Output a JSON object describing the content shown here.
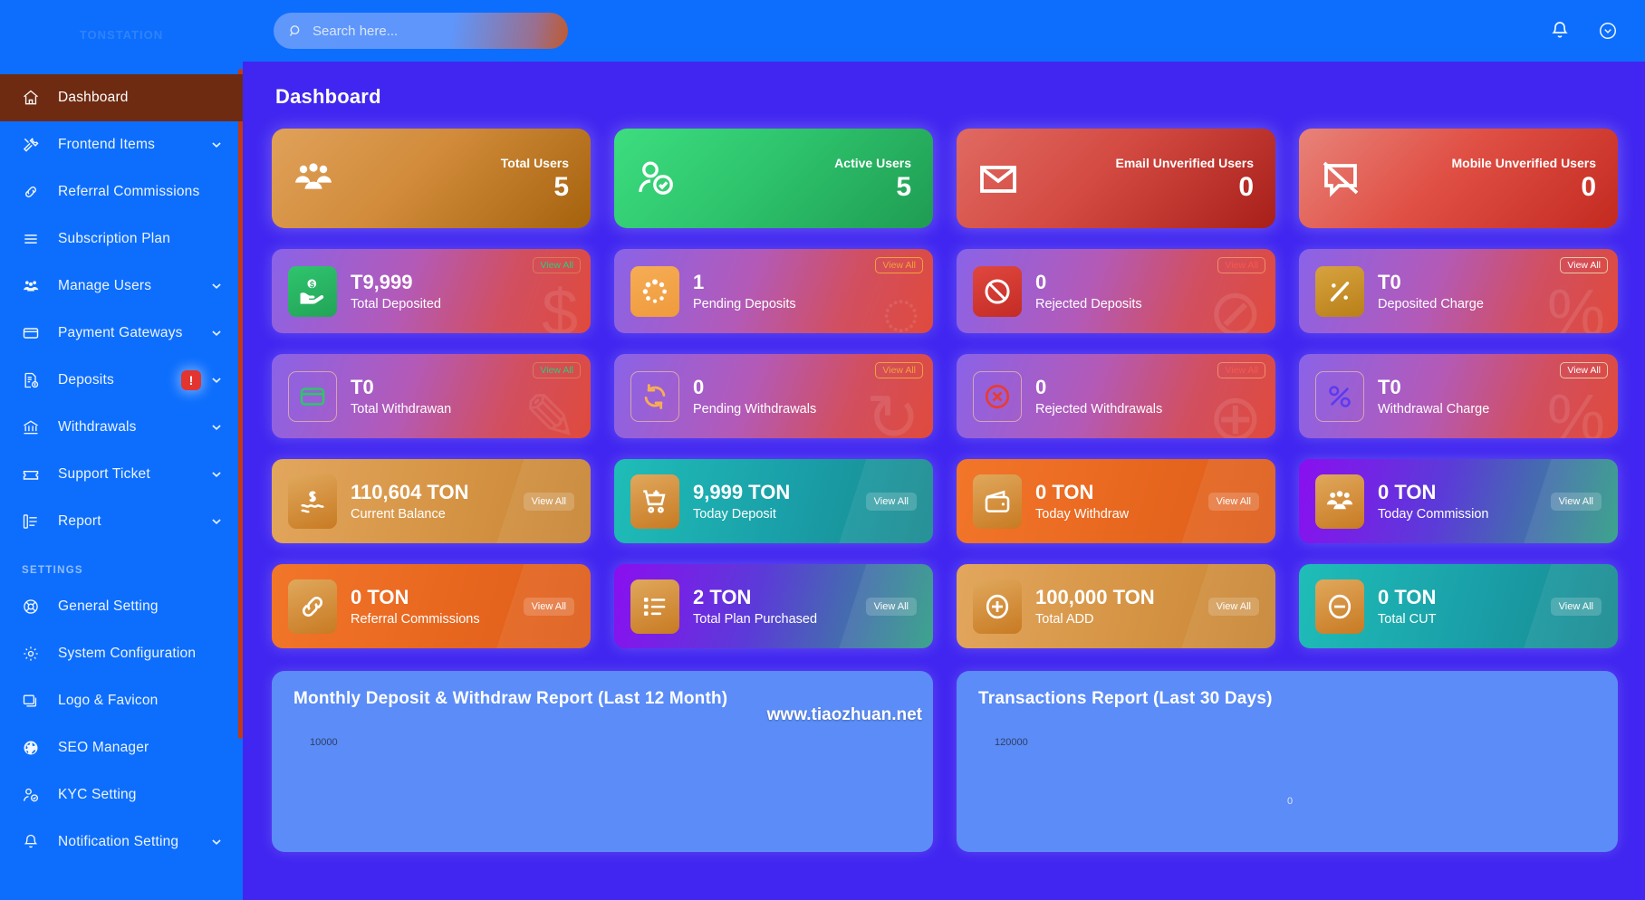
{
  "brand": {
    "logo_text": "TONSTATION"
  },
  "search": {
    "placeholder": "Search here...",
    "value": "",
    "icon": "search-icon"
  },
  "topbar": {
    "notification_icon": "bell-icon",
    "user_icon": "user-chevron-icon"
  },
  "page": {
    "title": "Dashboard"
  },
  "sidebar": {
    "settings_heading": "SETTINGS",
    "items": [
      {
        "label": "Dashboard",
        "icon": "home-icon",
        "active": true,
        "caret": false,
        "badge": null
      },
      {
        "label": "Frontend Items",
        "icon": "tools-icon",
        "active": false,
        "caret": true,
        "badge": null
      },
      {
        "label": "Referral Commissions",
        "icon": "link-icon",
        "active": false,
        "caret": false,
        "badge": null
      },
      {
        "label": "Subscription Plan",
        "icon": "list-lines-icon",
        "active": false,
        "caret": false,
        "badge": null
      },
      {
        "label": "Manage Users",
        "icon": "users-icon",
        "active": false,
        "caret": true,
        "badge": null
      },
      {
        "label": "Payment Gateways",
        "icon": "card-icon",
        "active": false,
        "caret": true,
        "badge": null
      },
      {
        "label": "Deposits",
        "icon": "invoice-dollar-icon",
        "active": false,
        "caret": true,
        "badge": "!"
      },
      {
        "label": "Withdrawals",
        "icon": "bank-icon",
        "active": false,
        "caret": true,
        "badge": null
      },
      {
        "label": "Support Ticket",
        "icon": "ticket-icon",
        "active": false,
        "caret": true,
        "badge": null
      },
      {
        "label": "Report",
        "icon": "report-list-icon",
        "active": false,
        "caret": true,
        "badge": null
      }
    ],
    "settings_items": [
      {
        "label": "General Setting",
        "icon": "lifebuoy-icon",
        "caret": false
      },
      {
        "label": "System Configuration",
        "icon": "gear-icon",
        "caret": false
      },
      {
        "label": "Logo & Favicon",
        "icon": "images-icon",
        "caret": false
      },
      {
        "label": "SEO Manager",
        "icon": "globe-icon",
        "caret": false
      },
      {
        "label": "KYC Setting",
        "icon": "user-check-icon",
        "caret": false
      },
      {
        "label": "Notification Setting",
        "icon": "bell-icon",
        "caret": true
      }
    ]
  },
  "stat_cards_row1": [
    {
      "label": "Total Users",
      "value": "5",
      "icon": "group-users-icon",
      "bg": "linear-gradient(135deg,#e0a15a 0%,#d18b3a 45%,#a5620d 100%)"
    },
    {
      "label": "Active Users",
      "value": "5",
      "icon": "user-check-icon",
      "bg": "linear-gradient(135deg,#3ddd7f 0%,#2ec46d 45%,#1f9c52 100%)"
    },
    {
      "label": "Email Unverified Users",
      "value": "0",
      "icon": "envelope-icon",
      "bg": "linear-gradient(135deg,#e06a62 0%,#d34a42 45%,#a81f1a 100%)"
    },
    {
      "label": "Mobile Unverified Users",
      "value": "0",
      "icon": "mobile-off-icon",
      "bg": "linear-gradient(135deg,#e8837a 0%,#e05045 45%,#c32a20 100%)"
    }
  ],
  "stat_cards_row2": [
    {
      "value": "T9,999",
      "label": "Total Deposited",
      "view_all": "View All",
      "view_all_style": "va-green",
      "icon": "hand-dollar-icon",
      "box_bg": "linear-gradient(160deg,#2fc46e,#22a457)",
      "icon_color": "#ffffff",
      "ghost": "$"
    },
    {
      "value": "1",
      "label": "Pending Deposits",
      "view_all": "View All",
      "view_all_style": "va-orange",
      "icon": "loading-dots-icon",
      "box_bg": "linear-gradient(160deg,#f6ad55,#ef9a3c)",
      "icon_color": "#ffffff",
      "ghost": "◌"
    },
    {
      "value": "0",
      "label": "Rejected Deposits",
      "view_all": "View All",
      "view_all_style": "va-red",
      "icon": "ban-icon",
      "box_bg": "linear-gradient(160deg,#e0473f,#c32b24)",
      "icon_color": "#ffffff",
      "ghost": "⊘"
    },
    {
      "value": "T0",
      "label": "Deposited Charge",
      "view_all": "View All",
      "view_all_style": "va-white",
      "icon": "percent-icon",
      "box_bg": "linear-gradient(160deg,#d7a33f,#b97f18)",
      "icon_color": "#ffffff",
      "ghost": "%"
    }
  ],
  "stat_cards_row3": [
    {
      "value": "T0",
      "label": "Total Withdrawan",
      "view_all": "View All",
      "view_all_style": "va-green",
      "icon": "wallet-rect-icon",
      "box_bg": "transparent",
      "box_border": "1px solid rgba(255,210,150,.6)",
      "icon_color": "#2fc46e",
      "ghost": "✎"
    },
    {
      "value": "0",
      "label": "Pending Withdrawals",
      "view_all": "View All",
      "view_all_style": "va-orange",
      "icon": "refresh-icon",
      "box_bg": "transparent",
      "box_border": "1px solid rgba(255,210,150,.6)",
      "icon_color": "#f6ad55",
      "ghost": "↻"
    },
    {
      "value": "0",
      "label": "Rejected Withdrawals",
      "view_all": "View All",
      "view_all_style": "va-red",
      "icon": "circle-x-icon",
      "box_bg": "transparent",
      "box_border": "1px solid rgba(255,210,150,.6)",
      "icon_color": "#e83c30",
      "ghost": "⊕"
    },
    {
      "value": "T0",
      "label": "Withdrawal Charge",
      "view_all": "View All",
      "view_all_style": "va-white",
      "icon": "percent-outline-icon",
      "box_bg": "transparent",
      "box_border": "1px solid rgba(255,210,150,.6)",
      "icon_color": "#5b3bf0",
      "ghost": "%"
    }
  ],
  "stat_cards_row4": [
    {
      "value": "110,604 TON",
      "label": "Current Balance",
      "view_all": "View All",
      "icon": "dollar-wave-icon",
      "bg": "linear-gradient(105deg,#e2a65d 0%,#d79647 50%,#c78432 100%)"
    },
    {
      "value": "9,999 TON",
      "label": "Today Deposit",
      "view_all": "View All",
      "icon": "cart-plus-icon",
      "bg": "linear-gradient(105deg,#1fbdb8 0%,#1a9fa8 55%,#17898f 100%)"
    },
    {
      "value": "0 TON",
      "label": "Today Withdraw",
      "view_all": "View All",
      "icon": "wallet-icon",
      "bg": "linear-gradient(105deg,#f2762a 0%,#e8671f 55%,#dd5c19 100%)"
    },
    {
      "value": "0 TON",
      "label": "Today Commission",
      "view_all": "View All",
      "icon": "group-users-icon",
      "bg": "linear-gradient(105deg,#8a0ff0 0%,#5b3bd8 45%,#2e9e84 100%)"
    }
  ],
  "stat_cards_row5": [
    {
      "value": "0 TON",
      "label": "Referral Commissions",
      "view_all": "View All",
      "icon": "link-icon",
      "bg": "linear-gradient(105deg,#f2762a 0%,#e8671f 55%,#dd5c19 100%)"
    },
    {
      "value": "2 TON",
      "label": "Total Plan Purchased",
      "view_all": "View All",
      "icon": "list-checks-icon",
      "bg": "linear-gradient(105deg,#8a0ff0 0%,#5b3bd8 45%,#2e9e84 100%)"
    },
    {
      "value": "100,000 TON",
      "label": "Total ADD",
      "view_all": "View All",
      "icon": "plus-circle-icon",
      "bg": "linear-gradient(105deg,#e2a65d 0%,#d79647 50%,#c78432 100%)"
    },
    {
      "value": "0 TON",
      "label": "Total CUT",
      "view_all": "View All",
      "icon": "minus-circle-icon",
      "bg": "linear-gradient(105deg,#1fbdb8 0%,#1a9fa8 55%,#17898f 100%)"
    }
  ],
  "watermark": "www.tiaozhuan.net",
  "chart_data": [
    {
      "type": "line",
      "title": "Monthly Deposit & Withdraw Report (Last 12 Month)",
      "ylabel": "",
      "xlabel": "",
      "ytick_visible": "10000",
      "ylim": [
        0,
        10000
      ],
      "categories": [],
      "series": [],
      "grid": false,
      "legend": "none"
    },
    {
      "type": "line",
      "title": "Transactions Report (Last 30 Days)",
      "ylabel": "",
      "xlabel": "",
      "ytick_visible": "120000",
      "point_label": "0",
      "ylim": [
        0,
        120000
      ],
      "categories": [],
      "series": [],
      "grid": false,
      "legend": "none"
    }
  ]
}
